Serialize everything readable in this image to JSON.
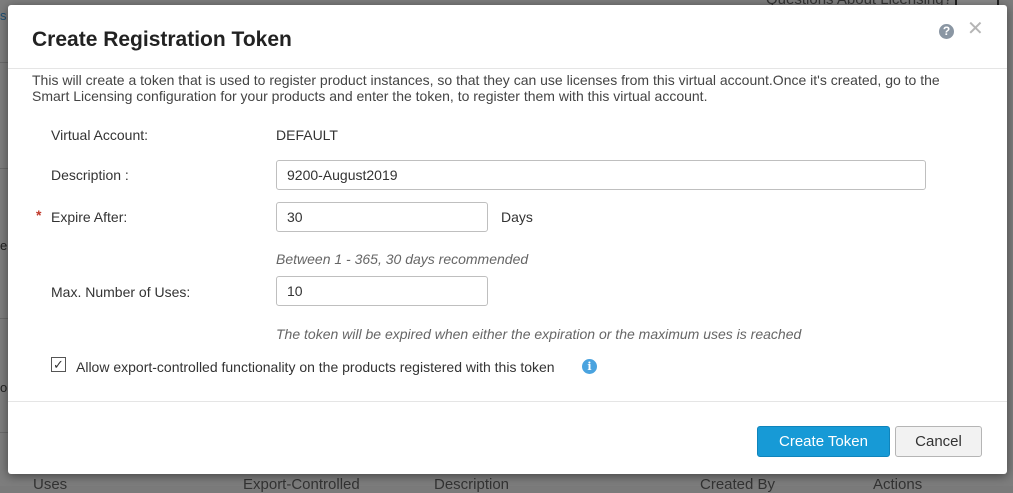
{
  "background": {
    "top_right_text": "Questions About Licensing?",
    "left_link_fragment": "s",
    "left_fragment_1": "e",
    "left_fragment_2": "o",
    "table_headers": [
      "Uses",
      "Export-Controlled",
      "Description",
      "Created By",
      "Actions"
    ]
  },
  "dialog": {
    "title": "Create Registration Token",
    "intro": "This will create a token that is used to register product instances, so that they can use licenses from this virtual account.Once it's created, go to the Smart Licensing configuration for your products and enter the token, to register them with this virtual account.",
    "help_icon_glyph": "?",
    "close_icon_glyph": "✕",
    "fields": {
      "virtual_account": {
        "label": "Virtual Account:",
        "value": "DEFAULT"
      },
      "description": {
        "label": "Description :",
        "value": "9200-August2019"
      },
      "expire_after": {
        "label": "Expire After:",
        "value": "30",
        "unit": "Days",
        "required_marker": "*",
        "hint": "Between 1 - 365, 30 days recommended"
      },
      "max_uses": {
        "label": "Max. Number of Uses:",
        "value": "10",
        "hint": "The token will be expired when either the expiration or the maximum uses is reached"
      }
    },
    "export_controlled": {
      "checked": true,
      "check_glyph": "✓",
      "label": "Allow export-controlled functionality on the products registered with this token",
      "info_glyph": "i"
    },
    "buttons": {
      "create": "Create Token",
      "cancel": "Cancel"
    }
  },
  "colors": {
    "primary": "#179ad6",
    "required": "#c0392b",
    "info": "#4aa3df",
    "overlay": "#7d7d7d"
  }
}
